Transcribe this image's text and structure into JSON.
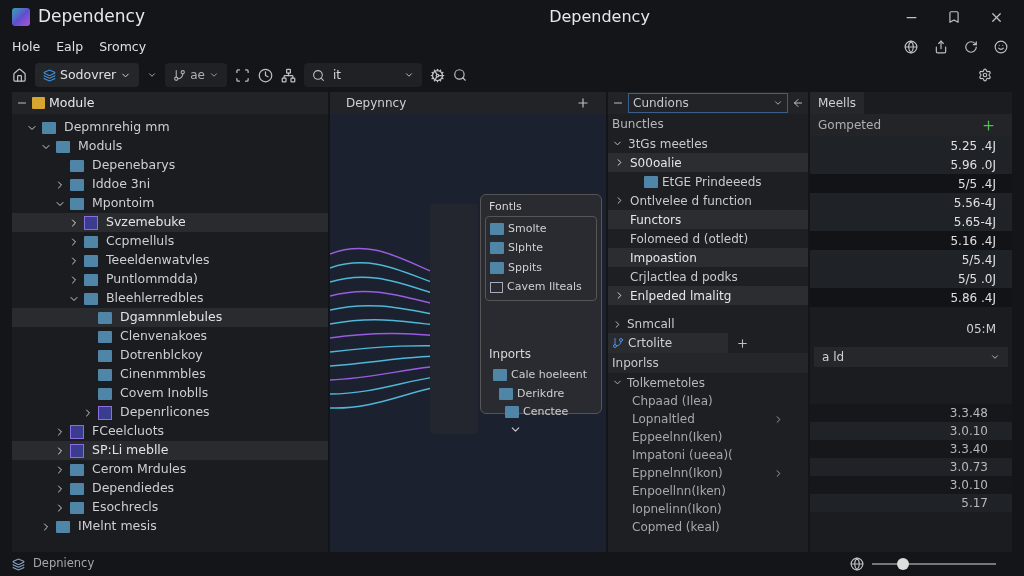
{
  "window": {
    "title": "Dependency",
    "center_title": "Dependency"
  },
  "menu": [
    "Hole",
    "Ealp",
    "Sromcy"
  ],
  "toolbar": {
    "project": "Sodovrer",
    "branch": "ae",
    "search": "it"
  },
  "left_panel": {
    "title": "Module",
    "tree": [
      {
        "label": "Depmnrehig mm",
        "kind": "folder",
        "selected": false,
        "expanded": true,
        "children": [
          {
            "label": "Moduls",
            "kind": "folder",
            "selected": false,
            "expanded": true,
            "children": [
              {
                "label": "Depenebarys",
                "kind": "folder",
                "selected": false
              },
              {
                "label": "Iddoe 3ni",
                "kind": "folder",
                "selected": false,
                "expanded": false
              },
              {
                "label": "Mpontoim",
                "kind": "folder",
                "selected": false,
                "expanded": true,
                "children": [
                  {
                    "label": "Svzemebuke",
                    "kind": "module",
                    "selected": true,
                    "expanded": false
                  },
                  {
                    "label": "Ccpmelluls",
                    "kind": "folder",
                    "selected": false,
                    "expanded": false
                  },
                  {
                    "label": "Teeeldenwatvles",
                    "kind": "folder",
                    "selected": false,
                    "expanded": false
                  },
                  {
                    "label": "Puntlommdda)",
                    "kind": "folder",
                    "selected": false,
                    "expanded": false
                  },
                  {
                    "label": "Bleehlerredbles",
                    "kind": "folder",
                    "selected": false,
                    "expanded": true,
                    "children": [
                      {
                        "label": "Dgamnmlebules",
                        "kind": "folder",
                        "selected": true
                      },
                      {
                        "label": "Clenvenakoes",
                        "kind": "folder",
                        "selected": false
                      },
                      {
                        "label": "Dotrenblckoy",
                        "kind": "folder",
                        "selected": false
                      },
                      {
                        "label": "Cinenmmbles",
                        "kind": "folder",
                        "selected": false
                      },
                      {
                        "label": "Covem Inoblls",
                        "kind": "folder",
                        "selected": false
                      },
                      {
                        "label": "Depenrlicones",
                        "kind": "module",
                        "selected": false,
                        "expanded": false
                      }
                    ]
                  }
                ]
              },
              {
                "label": "FCeelcluots",
                "kind": "module",
                "selected": false,
                "expanded": false
              },
              {
                "label": "SP:Li meblle",
                "kind": "module",
                "selected": true,
                "expanded": false
              },
              {
                "label": "Cerom Mrdules",
                "kind": "folder",
                "selected": false,
                "expanded": false
              },
              {
                "label": "Dependiedes",
                "kind": "folder",
                "selected": false,
                "expanded": false
              },
              {
                "label": "Esochrecls",
                "kind": "folder",
                "selected": false,
                "expanded": false
              }
            ]
          },
          {
            "label": "IMelnt mesis",
            "kind": "folder",
            "selected": false,
            "expanded": false
          }
        ]
      }
    ]
  },
  "center_panel": {
    "tab": "Depynncy",
    "popup": {
      "tab": "Fontls",
      "items": [
        {
          "label": "Smolte",
          "kind": "folder"
        },
        {
          "label": "Slphte",
          "kind": "folder"
        },
        {
          "label": "Sppits",
          "kind": "folder"
        },
        {
          "label": "Cavem Ilteals",
          "kind": "file"
        }
      ],
      "imports_title": "Inports",
      "imports": [
        "Cale hoeleent",
        "Derikdre",
        "Cenctee"
      ]
    }
  },
  "functions_panel": {
    "combo": "Cundions",
    "section": "Bunctles",
    "items": [
      {
        "label": "3tGs meetles",
        "kind": "group",
        "expanded": true,
        "selected": false
      },
      {
        "label": "S00oalie",
        "kind": "item",
        "expanded": false,
        "selected": true
      },
      {
        "label": "EtGE Prindeeeds",
        "kind": "folder",
        "selected": false
      },
      {
        "label": "Ontlvelee d function",
        "kind": "item",
        "expanded": false,
        "selected": false
      },
      {
        "label": "Functors",
        "kind": "item",
        "selected": true
      },
      {
        "label": "Folomeed d (otledt)",
        "kind": "item",
        "selected": false
      },
      {
        "label": "Impoastion",
        "kind": "item",
        "selected": true
      },
      {
        "label": "Crjlactlea d podks",
        "kind": "item",
        "selected": false
      },
      {
        "label": "Enlpeded lmalitg",
        "kind": "item",
        "expanded": false,
        "selected": true
      }
    ],
    "footer_item": "Snmcall",
    "tab": "Crtolite",
    "imports_title": "Inporlss",
    "imports_group": "Tolkemetoles",
    "imports": [
      {
        "label": "Chpaad (Ilea)",
        "submenu": false
      },
      {
        "label": "Lopnaltled",
        "submenu": true
      },
      {
        "label": "Eppeelnn(Iken)",
        "submenu": false
      },
      {
        "label": "Impatoni (ueea)(",
        "submenu": false
      },
      {
        "label": "Eppnelnn(Ikon)",
        "submenu": true
      },
      {
        "label": "Enpoellnn(Iken)",
        "submenu": false
      },
      {
        "label": "Iopnelinn(Ikon)",
        "submenu": false
      },
      {
        "label": "Copmed (keal)",
        "submenu": false
      }
    ]
  },
  "results_panel": {
    "tab": "Meells",
    "header": "Gompeted",
    "values": [
      "5.25 .4J",
      "5.96 .0J",
      "5/5 .4J",
      "5.56-4J",
      "5.65-4J",
      "5.16 .4J",
      "5/5.4J",
      "5/5 .0J",
      "5.86 .4J"
    ],
    "time": "05:M",
    "combo": "a ld",
    "values2": [
      "3.3.48",
      "3.0.10",
      "3.3.40",
      "3.0.73",
      "3.0.10",
      "5.17"
    ]
  },
  "status_bar": {
    "text": "Depniency",
    "zoom": {
      "level": 0.25
    }
  }
}
